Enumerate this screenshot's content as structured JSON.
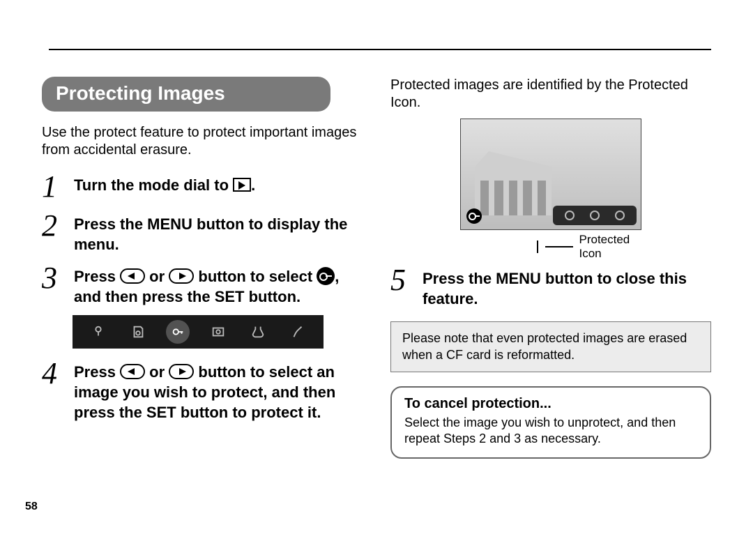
{
  "page_number": "58",
  "section_title": "Protecting Images",
  "intro": "Use the protect feature to protect important images from accidental erasure.",
  "steps": {
    "s1": {
      "num": "1",
      "pre": "Turn the mode dial to ",
      "post": "."
    },
    "s2": {
      "num": "2",
      "text": "Press the MENU button to display the menu."
    },
    "s3": {
      "num": "3",
      "p1": "Press ",
      "p2": " or ",
      "p3": " button to select ",
      "p4": ", and then press the SET button."
    },
    "s4": {
      "num": "4",
      "p1": "Press ",
      "p2": " or ",
      "p3": " button to select an image you wish to protect, and then press the SET button to protect it."
    },
    "s5": {
      "num": "5",
      "text": "Press the MENU button to close this feature."
    }
  },
  "col2_intro": "Protected images are identified by the Protected Icon.",
  "photo_label": "Protected Icon",
  "note": "Please note that even protected images are erased when a CF card is reformatted.",
  "tip": {
    "title": "To cancel protection...",
    "body": "Select the image you wish to unprotect, and then repeat Steps 2 and 3 as necessary."
  }
}
